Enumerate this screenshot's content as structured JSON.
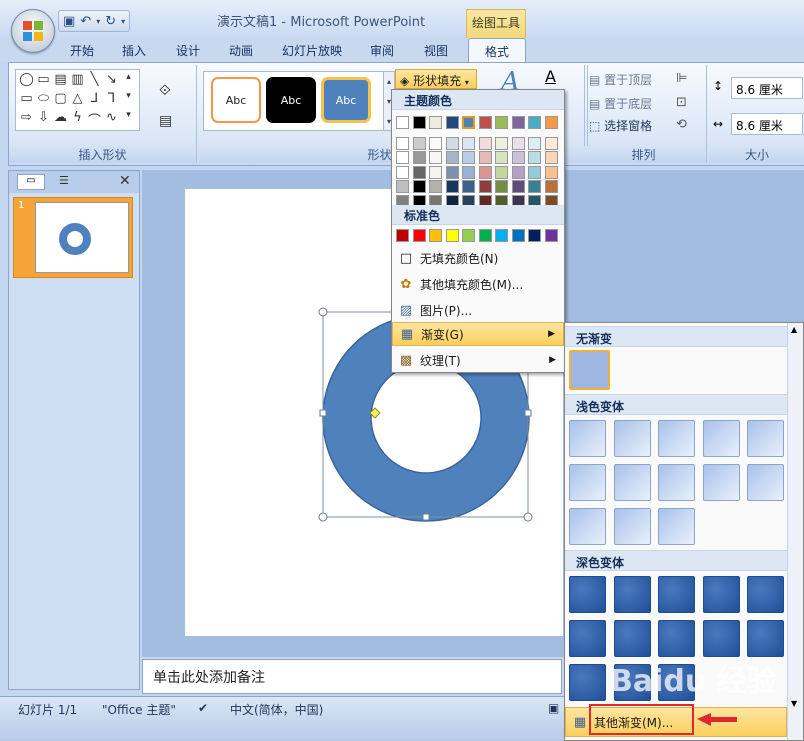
{
  "window": {
    "title": "演示文稿1 - Microsoft PowerPoint",
    "context_tool": "绘图工具"
  },
  "tabs": [
    "开始",
    "插入",
    "设计",
    "动画",
    "幻灯片放映",
    "审阅",
    "视图",
    "格式"
  ],
  "active_tab": "格式",
  "ribbon": {
    "insert_shapes_label": "插入形状",
    "shape_styles_label": "形状样式",
    "arrange_label": "排列",
    "size_label": "大小",
    "style_thumbs": [
      "Abc",
      "Abc",
      "Abc"
    ],
    "shape_fill_label": "形状填充",
    "arrange": {
      "bring_front": "置于顶层",
      "send_back": "置于底层",
      "selection_pane": "选择窗格"
    },
    "size": {
      "height": "8.6 厘米",
      "width": "8.6 厘米"
    }
  },
  "fill_menu": {
    "theme_colors_header": "主题颜色",
    "standard_colors_header": "标准色",
    "no_fill": "无填充颜色(N)",
    "more_fill": "其他填充颜色(M)...",
    "picture": "图片(P)...",
    "gradient": "渐变(G)",
    "texture": "纹理(T)",
    "theme_top_row": [
      "#ffffff",
      "#000000",
      "#eeece1",
      "#1f497d",
      "#4f81bd",
      "#c0504d",
      "#9bbb59",
      "#8064a2",
      "#4bacc6",
      "#f79646"
    ],
    "standard_colors": [
      "#c00000",
      "#ff0000",
      "#ffc000",
      "#ffff00",
      "#92d050",
      "#00b050",
      "#00b0f0",
      "#0070c0",
      "#002060",
      "#7030a0"
    ]
  },
  "gradient_menu": {
    "none_header": "无渐变",
    "light_header": "浅色变体",
    "dark_header": "深色变体",
    "more_gradients": "其他渐变(M)..."
  },
  "notes_placeholder": "单击此处添加备注",
  "status": {
    "slide": "幻灯片 1/1",
    "theme": "\"Office 主题\"",
    "language": "中文(简体，中国)"
  },
  "watermark": "Baidu 经验",
  "colors": {
    "shape_fill": "#4f81bd",
    "highlight": "#fbcf5c",
    "annotation": "#e0282e"
  }
}
